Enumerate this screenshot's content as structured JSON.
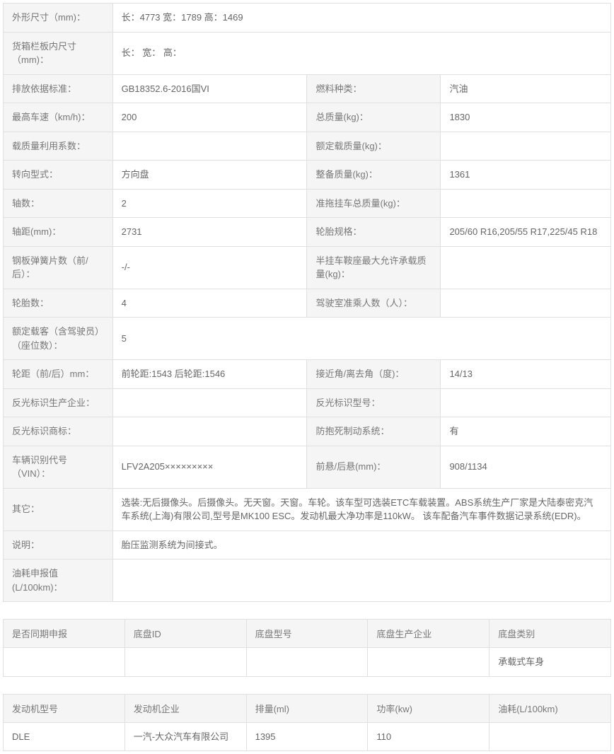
{
  "spec": {
    "dim_label": "外形尺寸（mm)：",
    "dim_value": "长：4773 宽：1789 高：1469",
    "cargo_label": "货箱栏板内尺寸（mm)：",
    "cargo_value": "长： 宽： 高：",
    "emission_label": "排放依据标准：",
    "emission_value": "GB18352.6-2016国VI",
    "fuel_label": "燃料种类：",
    "fuel_value": "汽油",
    "maxspeed_label": "最高车速（km/h)：",
    "maxspeed_value": "200",
    "totalmass_label": "总质量(kg)：",
    "totalmass_value": "1830",
    "loadfactor_label": "载质量利用系数：",
    "loadfactor_value": "",
    "ratedload_label": "额定载质量(kg)：",
    "ratedload_value": "",
    "steer_label": "转向型式：",
    "steer_value": "方向盘",
    "curbmass_label": "整备质量(kg)：",
    "curbmass_value": "1361",
    "axles_label": "轴数：",
    "axles_value": "2",
    "trailer_label": "准拖挂车总质量(kg)：",
    "trailer_value": "",
    "wheelbase_label": "轴距(mm)：",
    "wheelbase_value": "2731",
    "tirespec_label": "轮胎规格：",
    "tirespec_value": "205/60 R16,205/55 R17,225/45 R18",
    "spring_label": "钢板弹簧片数（前/后）：",
    "spring_value": "-/-",
    "saddle_label": "半挂车鞍座最大允许承载质量(kg)：",
    "saddle_value": "",
    "tirecount_label": "轮胎数：",
    "tirecount_value": "4",
    "cabseats_label": "驾驶室准乘人数（人）：",
    "cabseats_value": "",
    "seats_label": "额定载客（含驾驶员）（座位数）：",
    "seats_value": "5",
    "track_label": "轮距（前/后）mm：",
    "track_value": "前轮距:1543 后轮距:1546",
    "angle_label": "接近角/离去角（度)：",
    "angle_value": "14/13",
    "refmfr_label": "反光标识生产企业：",
    "refmfr_value": "",
    "refmodel_label": "反光标识型号：",
    "refmodel_value": "",
    "reftm_label": "反光标识商标：",
    "reftm_value": "",
    "abs_label": "防抱死制动系统：",
    "abs_value": "有",
    "vin_label": "车辆识别代号（VIN）：",
    "vin_value": "LFV2A205×××××××××",
    "overhang_label": "前悬/后悬(mm)：",
    "overhang_value": "908/1134",
    "other_label": "其它：",
    "other_value": "选装:无后摄像头。后摄像头。无天窗。天窗。车轮。该车型可选装ETC车载装置。ABS系统生产厂家是大陆泰密克汽车系统(上海)有限公司,型号是MK100 ESC。发动机最大净功率是110kW。 该车配备汽车事件数据记录系统(EDR)。",
    "note_label": "说明：",
    "note_value": "胎压监测系统为间接式。",
    "fuelcons_label": "油耗申报值(L/100km)：",
    "fuelcons_value": ""
  },
  "chassis": {
    "h1": "是否同期申报",
    "h2": "底盘ID",
    "h3": "底盘型号",
    "h4": "底盘生产企业",
    "h5": "底盘类别",
    "r1c1": "",
    "r1c2": "",
    "r1c3": "",
    "r1c4": "",
    "r1c5": "承载式车身"
  },
  "engine": {
    "h1": "发动机型号",
    "h2": "发动机企业",
    "h3": "排量(ml)",
    "h4": "功率(kw)",
    "h5": "油耗(L/100km)",
    "r1c1": "DLE",
    "r1c2": "一汽-大众汽车有限公司",
    "r1c3": "1395",
    "r1c4": "110",
    "r1c5": ""
  }
}
